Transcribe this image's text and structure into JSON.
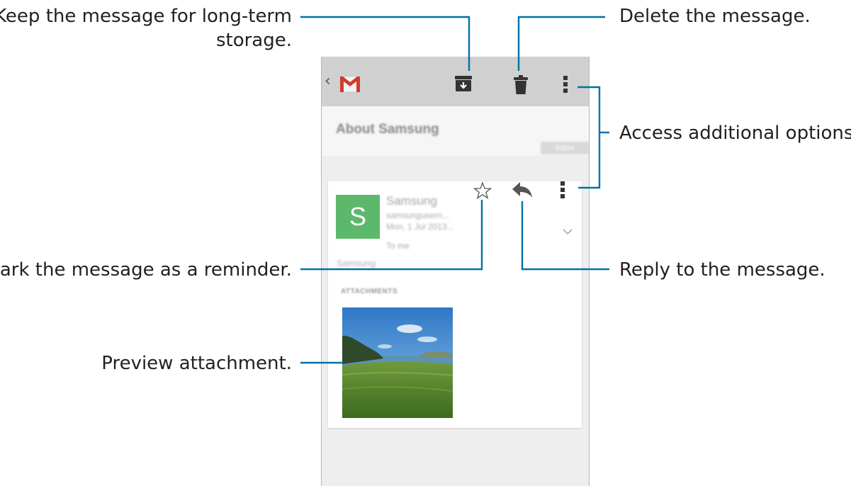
{
  "callouts": {
    "archive": "Keep the message for long-term",
    "archive_line2": "storage.",
    "delete": "Delete the message.",
    "options": "Access additional options.",
    "reminder": "Mark the message as a reminder.",
    "reply": "Reply to the message.",
    "preview": "Preview attachment."
  },
  "actionbar": {
    "back_glyph": "‹",
    "icons": [
      "gmail-logo",
      "archive-icon",
      "delete-icon",
      "overflow-menu-icon"
    ]
  },
  "message": {
    "subject": "About Samsung",
    "label": "Inbox",
    "avatar_letter": "S",
    "sender_name": "Samsung",
    "sender_email": "samsungusern...",
    "date": "Mon, 1 Jul 2013...",
    "to": "To me",
    "body": "Samsung",
    "attachments_label": "ATTACHMENTS"
  },
  "colors": {
    "callout_line": "#0071a8",
    "actionbar": "#d0d0d0",
    "avatar": "#5cb86a",
    "gmail_red": "#d33a2c"
  }
}
